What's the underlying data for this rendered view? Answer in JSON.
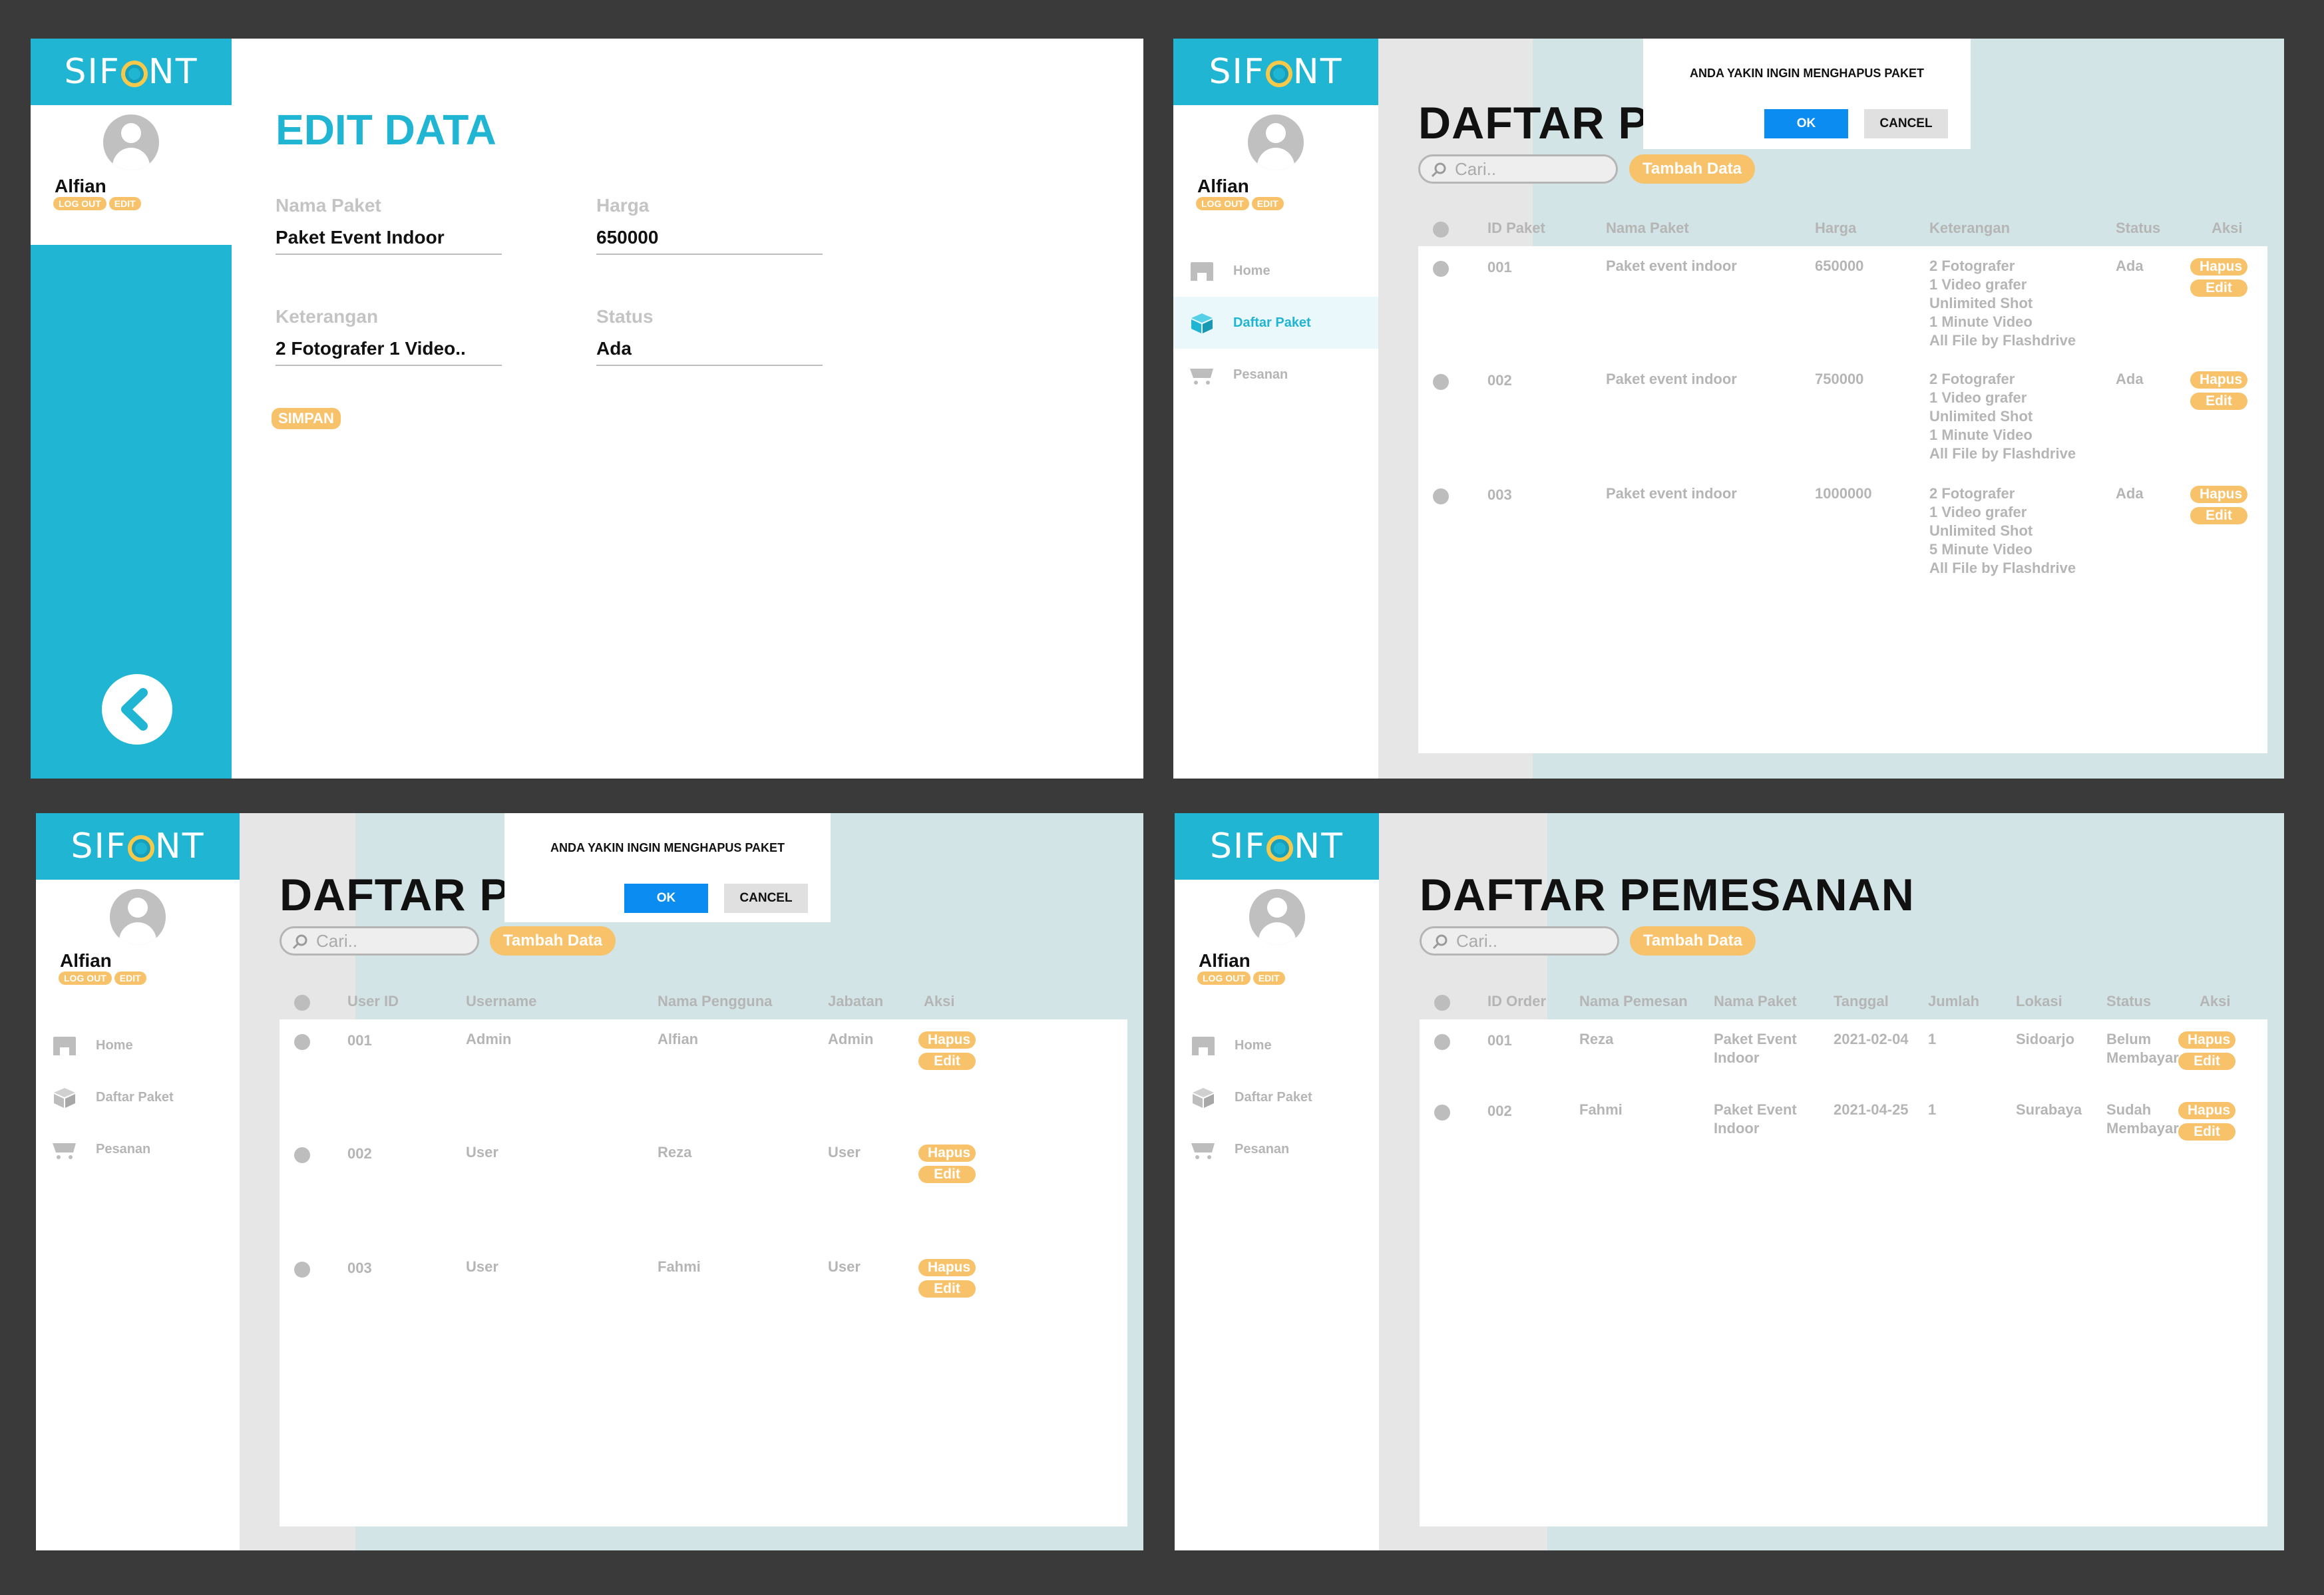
{
  "brand": {
    "logo_left": "SIF",
    "logo_right": "NT",
    "color_primary": "#1fb5d3",
    "color_accent": "#f7c26a",
    "color_ok": "#0a8cf0"
  },
  "profile": {
    "name": "Alfian",
    "logout_label": "LOG OUT",
    "edit_label": "EDIT"
  },
  "menu": {
    "home": "Home",
    "daftar_paket": "Daftar Paket",
    "pesanan": "Pesanan"
  },
  "common": {
    "search_placeholder": "Cari..",
    "add_label": "Tambah Data",
    "hapus_label": "Hapus",
    "edit_label": "Edit"
  },
  "dialog": {
    "message": "ANDA YAKIN INGIN MENGHAPUS PAKET",
    "ok_label": "OK",
    "cancel_label": "CANCEL"
  },
  "edit_page": {
    "title": "EDIT DATA",
    "fields": {
      "nama_paket": {
        "label": "Nama Paket",
        "value": "Paket Event Indoor"
      },
      "harga": {
        "label": "Harga",
        "value": "650000"
      },
      "keterangan": {
        "label": "Keterangan",
        "value": "2 Fotografer 1 Video.."
      },
      "status": {
        "label": "Status",
        "value": "Ada"
      }
    },
    "save_label": "SIMPAN",
    "back_icon": "chevron-left-icon"
  },
  "paket_page": {
    "title": "DAFTAR PAKET",
    "columns": [
      "ID Paket",
      "Nama Paket",
      "Harga",
      "Keterangan",
      "Status",
      "Aksi"
    ],
    "rows": [
      {
        "id": "001",
        "nama": "Paket event indoor",
        "harga": "650000",
        "ket": [
          "2 Fotografer",
          "1 Video grafer",
          "Unlimited Shot",
          "1 Minute Video",
          "All File by Flashdrive"
        ],
        "status": "Ada"
      },
      {
        "id": "002",
        "nama": "Paket event indoor",
        "harga": "750000",
        "ket": [
          "2 Fotografer",
          "1 Video grafer",
          "Unlimited Shot",
          "1 Minute Video",
          "All File by Flashdrive"
        ],
        "status": "Ada"
      },
      {
        "id": "003",
        "nama": "Paket event indoor",
        "harga": "1000000",
        "ket": [
          "2 Fotografer",
          "1 Video grafer",
          "Unlimited Shot",
          "5 Minute Video",
          "All File by Flashdrive"
        ],
        "status": "Ada"
      }
    ]
  },
  "user_page": {
    "title": "DAFTAR PENGGUNA",
    "columns": [
      "User ID",
      "Username",
      "Nama Pengguna",
      "Jabatan",
      "Aksi"
    ],
    "rows": [
      {
        "id": "001",
        "username": "Admin",
        "nama": "Alfian",
        "jabatan": "Admin"
      },
      {
        "id": "002",
        "username": "User",
        "nama": "Reza",
        "jabatan": "User"
      },
      {
        "id": "003",
        "username": "User",
        "nama": "Fahmi",
        "jabatan": "User"
      }
    ]
  },
  "pesanan_page": {
    "title": "DAFTAR PEMESANAN",
    "columns": [
      "ID Order",
      "Nama Pemesan",
      "Nama Paket",
      "Tanggal",
      "Jumlah",
      "Lokasi",
      "Status",
      "Aksi"
    ],
    "rows": [
      {
        "id": "001",
        "pemesan": "Reza",
        "paket": [
          "Paket Event",
          "Indoor"
        ],
        "tanggal": "2021-02-04",
        "jumlah": "1",
        "lokasi": "Sidoarjo",
        "status": [
          "Belum",
          "Membayar"
        ]
      },
      {
        "id": "002",
        "pemesan": "Fahmi",
        "paket": [
          "Paket Event",
          "Indoor"
        ],
        "tanggal": "2021-04-25",
        "jumlah": "1",
        "lokasi": "Surabaya",
        "status": [
          "Sudah",
          "Membayar"
        ]
      }
    ]
  }
}
